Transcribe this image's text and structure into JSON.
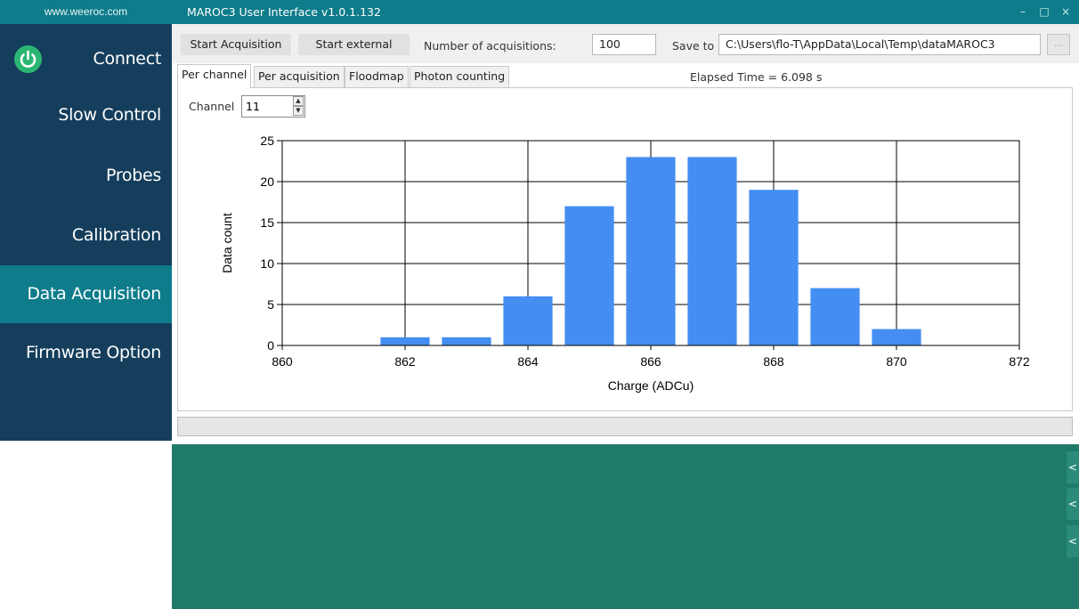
{
  "sidebar": {
    "site": "www.weeroc.com",
    "items": [
      {
        "label": "Connect"
      },
      {
        "label": "Slow Control"
      },
      {
        "label": "Probes"
      },
      {
        "label": "Calibration"
      },
      {
        "label": "Data Acquisition",
        "active": true
      },
      {
        "label": "Firmware Option"
      }
    ]
  },
  "window": {
    "title": "MAROC3 User Interface v1.0.1.132",
    "minimize": "–",
    "maximize": "□",
    "close": "×"
  },
  "toolbar": {
    "start_acq": "Start Acquisition",
    "start_ext": "Start external",
    "num_acq_label": "Number of acquisitions:",
    "num_acq_value": "100",
    "save_to_label": "Save to",
    "save_path": "C:\\Users\\flo-T\\AppData\\Local\\Temp\\dataMAROC3",
    "browse": "..."
  },
  "tabs": [
    "Per channel",
    "Per acquisition",
    "Floodmap",
    "Photon counting"
  ],
  "elapsed": "Elapsed Time = 6.098 s",
  "channel": {
    "label": "Channel",
    "value": "11"
  },
  "progress": 0,
  "console": {
    "expand": "<"
  },
  "colors": {
    "sidebar": "#153e5c",
    "accent": "#0e7c8a",
    "bar": "#448ef2",
    "console": "#1f7a6a"
  },
  "chart_data": {
    "type": "bar",
    "x": [
      862,
      863,
      864,
      865,
      866,
      867,
      868,
      869,
      870
    ],
    "values": [
      1,
      1,
      6,
      17,
      23,
      23,
      19,
      7,
      2
    ],
    "xlabel": "Charge (ADCu)",
    "ylabel": "Data count",
    "xlim": [
      860,
      872
    ],
    "ylim": [
      0,
      25
    ],
    "xticks": [
      "860",
      "862",
      "864",
      "866",
      "868",
      "870",
      "872"
    ],
    "yticks": [
      "0",
      "5",
      "10",
      "15",
      "20",
      "25"
    ],
    "grid": true
  }
}
